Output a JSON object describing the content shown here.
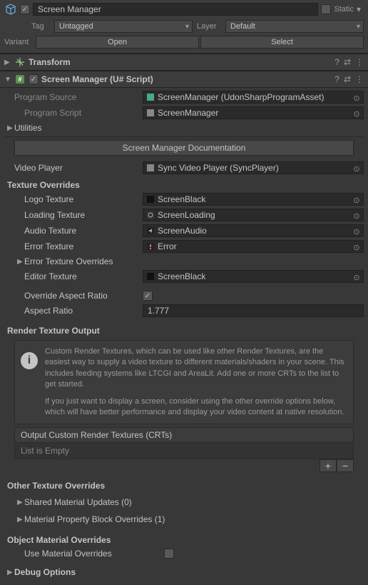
{
  "header": {
    "name": "Screen Manager",
    "enabled": true,
    "static_label": "Static",
    "tag_label": "Tag",
    "tag_value": "Untagged",
    "layer_label": "Layer",
    "layer_value": "Default",
    "variant_label": "Variant",
    "open_btn": "Open",
    "select_btn": "Select"
  },
  "transform": {
    "title": "Transform"
  },
  "component": {
    "title": "Screen Manager (U# Script)",
    "program_source_label": "Program Source",
    "program_source_value": "ScreenManager (UdonSharpProgramAsset)",
    "program_script_label": "Program Script",
    "program_script_value": "ScreenManager",
    "utilities_label": "Utilities",
    "doc_button": "Screen Manager Documentation",
    "video_player_label": "Video Player",
    "video_player_value": "Sync Video Player (SyncPlayer)",
    "texture_overrides_header": "Texture Overrides",
    "logo_texture_label": "Logo Texture",
    "logo_texture_value": "ScreenBlack",
    "loading_texture_label": "Loading Texture",
    "loading_texture_value": "ScreenLoading",
    "audio_texture_label": "Audio Texture",
    "audio_texture_value": "ScreenAudio",
    "error_texture_label": "Error Texture",
    "error_texture_value": "Error",
    "error_overrides_label": "Error Texture Overrides",
    "editor_texture_label": "Editor Texture",
    "editor_texture_value": "ScreenBlack",
    "override_aspect_label": "Override Aspect Ratio",
    "aspect_ratio_label": "Aspect Ratio",
    "aspect_ratio_value": "1.777",
    "render_output_header": "Render Texture Output",
    "info_text1": "Custom Render Textures, which can be used like other Render Textures, are the easiest way to supply a video texture to different materials/shaders in your scene.  This includes feeding systems like LTCGI and AreaLit.  Add one or more CRTs to the list to get started.",
    "info_text2": "If you just want to display a screen, consider using the other override options below, which will have better performance and display your video content at native resolution.",
    "crt_list_header": "Output Custom Render Textures (CRTs)",
    "crt_list_empty": "List is Empty",
    "other_overrides_header": "Other Texture Overrides",
    "shared_material_label": "Shared Material Updates (0)",
    "property_block_label": "Material Property Block Overrides (1)",
    "object_material_header": "Object Material Overrides",
    "use_material_label": "Use Material Overrides",
    "debug_options_label": "Debug Options"
  }
}
